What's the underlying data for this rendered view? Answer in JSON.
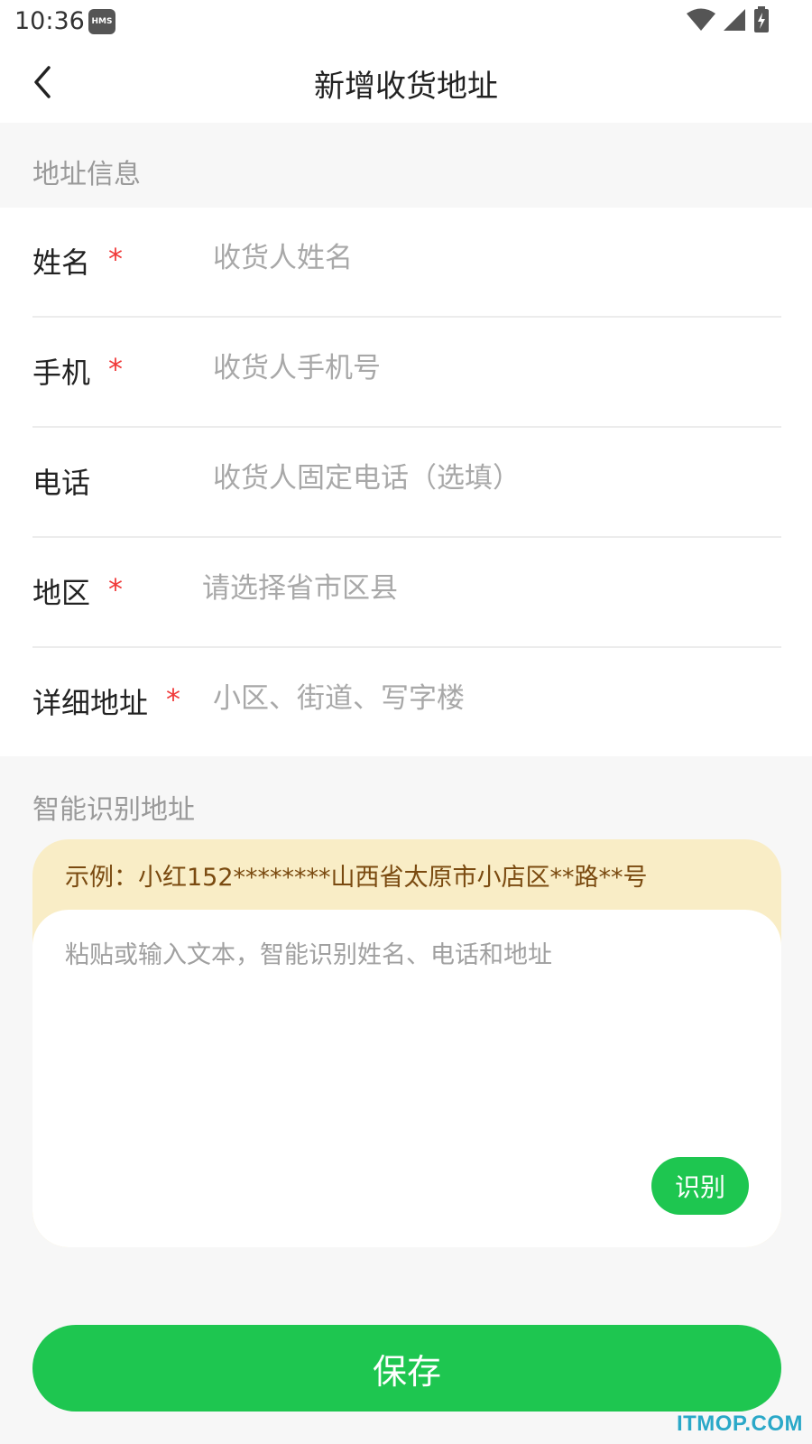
{
  "status_bar": {
    "time": "10:36",
    "hms_badge": "HMS",
    "icons": [
      "wifi-icon",
      "signal-icon",
      "battery-charging-icon"
    ]
  },
  "nav": {
    "back_icon": "chevron-left-icon",
    "title": "新增收货地址"
  },
  "address_section": {
    "title": "地址信息",
    "fields": [
      {
        "label": "姓名",
        "required": true,
        "required_mark": "*",
        "placeholder": "收货人姓名",
        "value": ""
      },
      {
        "label": "手机",
        "required": true,
        "required_mark": "*",
        "placeholder": "收货人手机号",
        "value": ""
      },
      {
        "label": "电话",
        "required": false,
        "required_mark": "",
        "placeholder": "收货人固定电话（选填）",
        "value": ""
      },
      {
        "label": "地区",
        "required": true,
        "required_mark": "*",
        "placeholder": "请选择省市区县",
        "value": ""
      },
      {
        "label": "详细地址",
        "required": true,
        "required_mark": "*",
        "placeholder": "小区、街道、写字楼",
        "value": ""
      }
    ]
  },
  "smart_section": {
    "title": "智能识别地址",
    "example": "示例：小红152********山西省太原市小店区**路**号",
    "placeholder": "粘贴或输入文本，智能识别姓名、电话和地址",
    "recognize_label": "识别"
  },
  "save_label": "保存",
  "watermark": "ITMOP.COM",
  "colors": {
    "accent_green": "#1ec650",
    "required_red": "#f03a3a",
    "example_bg": "#f9edc6",
    "example_text": "#7a4a10",
    "page_bg": "#f7f7f7"
  }
}
